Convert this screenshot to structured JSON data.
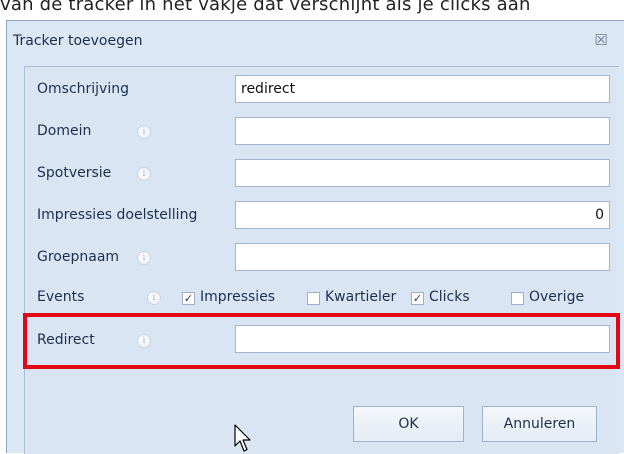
{
  "doc_text": "van de tracker in het vakje dat verschijnt als je clicks aan",
  "dialog": {
    "title": "Tracker toevoegen",
    "close_symbol": "☒"
  },
  "form": {
    "omschrijving": {
      "label": "Omschrijving",
      "value": "redirect"
    },
    "domein": {
      "label": "Domein",
      "value": ""
    },
    "spotversie": {
      "label": "Spotversie",
      "value": ""
    },
    "impressies": {
      "label": "Impressies doelstelling",
      "value": "0"
    },
    "groepnaam": {
      "label": "Groepnaam",
      "value": ""
    },
    "events": {
      "label": "Events",
      "options": [
        {
          "label": "Impressies",
          "checked": true
        },
        {
          "label": "Kwartieler",
          "checked": false
        },
        {
          "label": "Clicks",
          "checked": true
        },
        {
          "label": "Overige",
          "checked": false
        }
      ]
    },
    "redirect": {
      "label": "Redirect",
      "value": ""
    }
  },
  "buttons": {
    "ok": "OK",
    "cancel": "Annuleren"
  },
  "icons": {
    "info": "info-icon",
    "close": "close-icon",
    "cursor": "mouse-pointer-icon"
  },
  "colors": {
    "highlight": "#e30613",
    "dialog_bg": "#dce7f5"
  }
}
